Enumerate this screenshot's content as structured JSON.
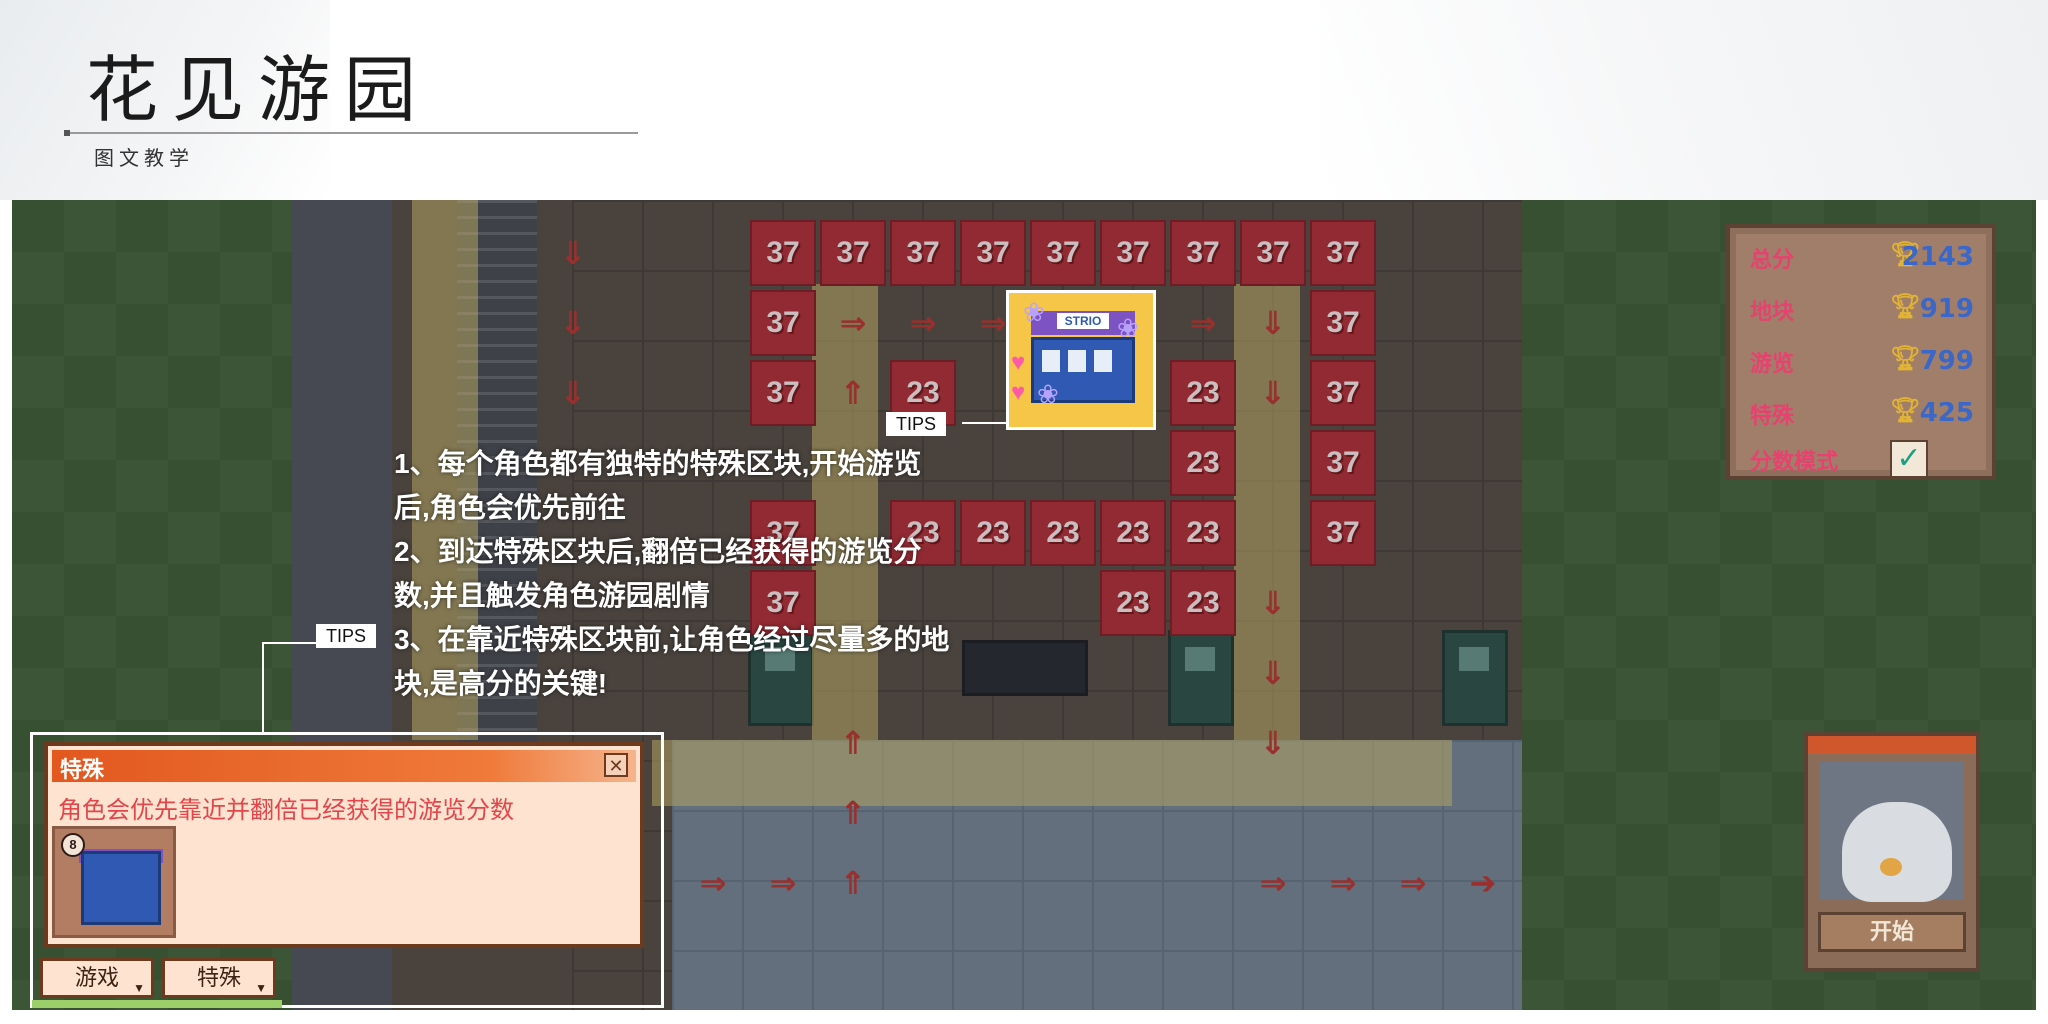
{
  "header": {
    "title": "花见游园",
    "subtitle": "图文教学"
  },
  "board": {
    "tiles": [
      {
        "row": 0,
        "col": 0,
        "v": "37"
      },
      {
        "row": 0,
        "col": 1,
        "v": "37"
      },
      {
        "row": 0,
        "col": 2,
        "v": "37"
      },
      {
        "row": 0,
        "col": 3,
        "v": "37"
      },
      {
        "row": 0,
        "col": 4,
        "v": "37"
      },
      {
        "row": 0,
        "col": 5,
        "v": "37"
      },
      {
        "row": 0,
        "col": 6,
        "v": "37"
      },
      {
        "row": 0,
        "col": 7,
        "v": "37"
      },
      {
        "row": 0,
        "col": 8,
        "v": "37"
      },
      {
        "row": 1,
        "col": 0,
        "v": "37"
      },
      {
        "row": 1,
        "col": 8,
        "v": "37"
      },
      {
        "row": 2,
        "col": 0,
        "v": "37"
      },
      {
        "row": 2,
        "col": 2,
        "v": "23"
      },
      {
        "row": 2,
        "col": 6,
        "v": "23"
      },
      {
        "row": 2,
        "col": 8,
        "v": "37"
      },
      {
        "row": 3,
        "col": 6,
        "v": "23"
      },
      {
        "row": 3,
        "col": 8,
        "v": "37"
      },
      {
        "row": 4,
        "col": 0,
        "v": "37"
      },
      {
        "row": 4,
        "col": 2,
        "v": "23"
      },
      {
        "row": 4,
        "col": 3,
        "v": "23"
      },
      {
        "row": 4,
        "col": 4,
        "v": "23"
      },
      {
        "row": 4,
        "col": 5,
        "v": "23"
      },
      {
        "row": 4,
        "col": 6,
        "v": "23"
      },
      {
        "row": 4,
        "col": 8,
        "v": "37"
      },
      {
        "row": 5,
        "col": 0,
        "v": "37"
      },
      {
        "row": 5,
        "col": 5,
        "v": "23"
      },
      {
        "row": 5,
        "col": 6,
        "v": "23"
      }
    ],
    "arrows": [
      {
        "row": 0,
        "col": -3,
        "v": "⇓"
      },
      {
        "row": 1,
        "col": -3,
        "v": "⇓"
      },
      {
        "row": 2,
        "col": -3,
        "v": "⇓"
      },
      {
        "row": 1,
        "col": 1,
        "v": "⇒"
      },
      {
        "row": 1,
        "col": 2,
        "v": "⇒"
      },
      {
        "row": 1,
        "col": 3,
        "v": "⇒"
      },
      {
        "row": 1,
        "col": 6,
        "v": "⇒"
      },
      {
        "row": 1,
        "col": 7,
        "v": "⇓"
      },
      {
        "row": 2,
        "col": 7,
        "v": "⇓"
      },
      {
        "row": 2,
        "col": 1,
        "v": "⇑"
      },
      {
        "row": 5,
        "col": 7,
        "v": "⇓"
      },
      {
        "row": 6,
        "col": 7,
        "v": "⇓"
      },
      {
        "row": 7,
        "col": 7,
        "v": "⇓"
      },
      {
        "row": 7,
        "col": 1,
        "v": "⇑"
      },
      {
        "row": 8,
        "col": 1,
        "v": "⇑"
      },
      {
        "row": 9,
        "col": -1,
        "v": "⇒"
      },
      {
        "row": 9,
        "col": 0,
        "v": "⇒"
      },
      {
        "row": 9,
        "col": 1,
        "v": "⇑"
      },
      {
        "row": 9,
        "col": 7,
        "v": "⇒"
      },
      {
        "row": 9,
        "col": 8,
        "v": "⇒"
      },
      {
        "row": 9,
        "col": 9,
        "v": "⇒"
      },
      {
        "row": 9,
        "col": 10,
        "v": "➔"
      }
    ],
    "stand_sign": "STRIO"
  },
  "tips": {
    "tag": "TIPS",
    "lines": [
      "1、每个角色都有独特的特殊区块,开始游览",
      "后,角色会优先前往",
      "2、到达特殊区块后,翻倍已经获得的游览分",
      "数,并且触发角色游园剧情",
      "3、在靠近特殊区块前,让角色经过尽量多的地",
      "块,是高分的关键!"
    ]
  },
  "score": {
    "rows": [
      {
        "label": "总分",
        "value": "2143"
      },
      {
        "label": "地块",
        "value": "919"
      },
      {
        "label": "游览",
        "value": "799"
      },
      {
        "label": "特殊",
        "value": "425"
      }
    ],
    "mode_label": "分数模式",
    "mode_checked": true
  },
  "dialog": {
    "title": "特殊",
    "description": "角色会优先靠近并翻倍已经获得的游览分数",
    "thumb_badge": "8",
    "close_glyph": "✕"
  },
  "tabs": [
    {
      "label": "游戏"
    },
    {
      "label": "特殊"
    }
  ],
  "portrait": {
    "start_label": "开始",
    "top_glyph": "◂▸"
  },
  "colors": {
    "tile_red": "#b7323a",
    "path_yellow": "#c6a642",
    "dialog_header": "#e2581f",
    "dialog_text": "#e2464a",
    "score_value": "#3b67c8",
    "score_label": "#e7416f"
  }
}
